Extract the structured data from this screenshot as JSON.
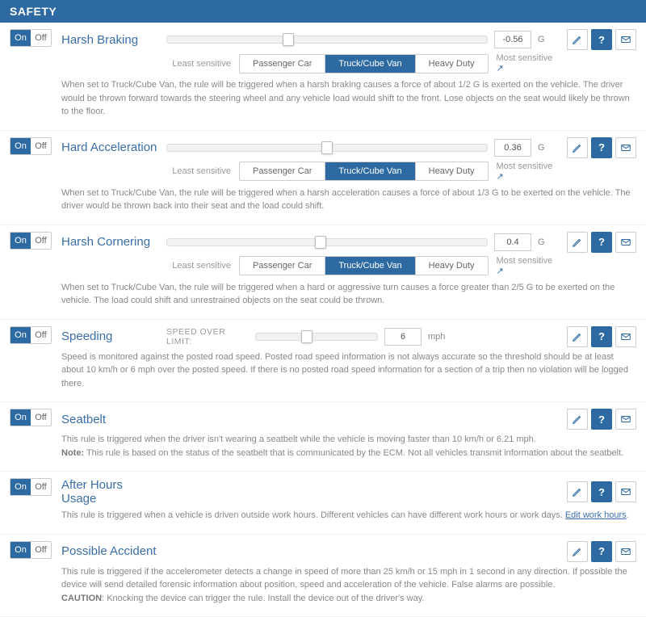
{
  "header": "SAFETY",
  "ui": {
    "on": "On",
    "off": "Off",
    "least": "Least sensitive",
    "most": "Most sensitive",
    "seg": [
      "Passenger Car",
      "Truck/Cube Van",
      "Heavy Duty"
    ],
    "g": "G",
    "mph": "mph",
    "speed_over": "SPEED OVER LIMIT:"
  },
  "rules": [
    {
      "title": "Harsh Braking",
      "value": "-0.56",
      "thumb": 38,
      "seg": 1,
      "desc": "When set to Truck/Cube Van, the rule will be triggered when a harsh braking causes a force of about 1/2 G is exerted on the vehicle. The driver would be thrown forward towards the steering wheel and any vehicle load would shift to the front. Lose objects on the seat would likely be thrown to the floor."
    },
    {
      "title": "Hard Acceleration",
      "value": "0.36",
      "thumb": 50,
      "seg": 1,
      "desc": "When set to Truck/Cube Van, the rule will be triggered when a harsh acceleration causes a force of about 1/3 G to be exerted on the vehicle. The driver would be thrown back into their seat and the load could shift."
    },
    {
      "title": "Harsh Cornering",
      "value": "0.4",
      "thumb": 48,
      "seg": 1,
      "desc": "When set to Truck/Cube Van, the rule will be triggered when a hard or aggressive turn causes a force greater than 2/5 G to be exerted on the vehicle. The load could shift and unrestrained objects on the seat could be thrown."
    },
    {
      "title": "Speeding",
      "value": "6",
      "thumb": 42,
      "desc": "Speed is monitored against the posted road speed. Posted road speed information is not always accurate so the threshold should be at least about 10 km/h or 6 mph over the posted speed. If there is no posted road speed information for a section of a trip then no violation will be logged there."
    },
    {
      "title": "Seatbelt",
      "desc": "This rule is triggered when the driver isn't wearing a seatbelt while the vehicle is moving faster than 10 km/h or 6.21 mph.",
      "note": "Note:",
      "note_text": " This rule is based on the status of the seatbelt that is communicated by the ECM. Not all vehicles transmit information about the seatbelt."
    },
    {
      "title": "After Hours Usage",
      "desc": "This rule is triggered when a vehicle is driven outside work hours. Different vehicles can have different work hours or work days. ",
      "link": "Edit work hours"
    },
    {
      "title": "Possible Accident",
      "desc": "This rule is triggered if the accelerometer detects a change in speed of more than 25 km/h or 15 mph in 1 second in any direction. If possible the device will send detailed forensic information about position, speed and acceleration of the vehicle. False alarms are possible.",
      "caution": "CAUTION",
      "caution_text": ": Knocking the device can trigger the rule. Install the device out of the driver's way."
    }
  ]
}
